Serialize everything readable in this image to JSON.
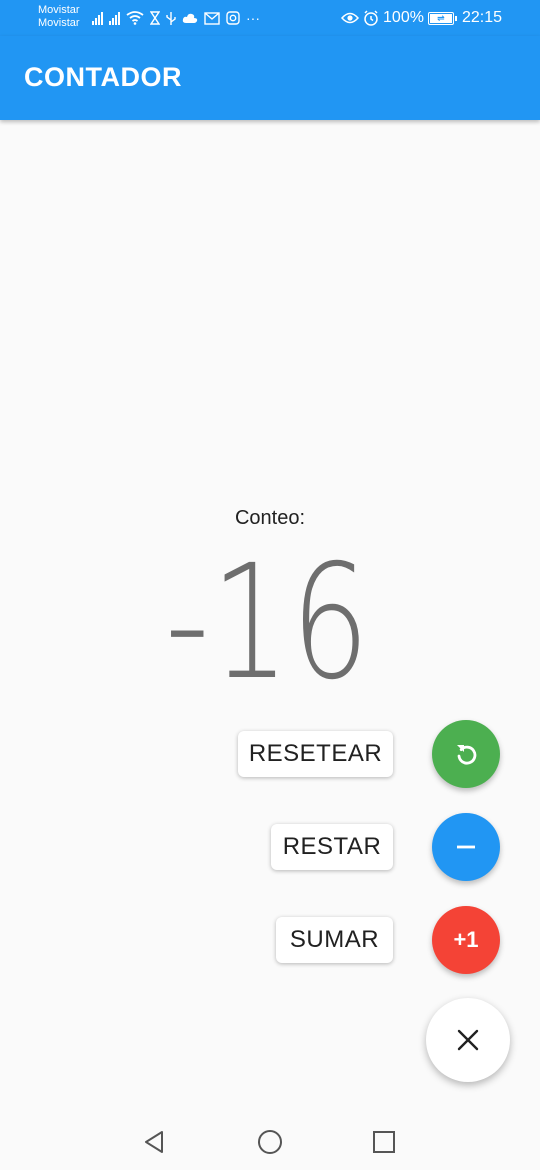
{
  "status_bar": {
    "carrier_1": "Movistar",
    "carrier_2": "Movistar",
    "left_icons": [
      "signal-icon",
      "signal-icon",
      "wifi-icon",
      "hourglass-icon",
      "usb-icon",
      "cloud-icon",
      "mail-icon",
      "instagram-icon",
      "more-icon"
    ],
    "more": "···",
    "battery_percent": "100%",
    "time": "22:15"
  },
  "app_bar": {
    "title": "CONTADOR",
    "color": "#2196f3"
  },
  "counter": {
    "label": "Conteo:",
    "value": "-16"
  },
  "speed_dial": {
    "reset": {
      "label": "RESETEAR",
      "icon": "refresh-icon",
      "color": "#4caf50"
    },
    "subtract": {
      "label": "RESTAR",
      "icon": "minus-icon",
      "color": "#2196f3"
    },
    "add": {
      "label": "SUMAR",
      "icon_text": "+1",
      "color": "#f44336"
    },
    "close": {
      "icon": "close-icon"
    }
  },
  "nav_bar": {
    "icons": [
      "back-icon",
      "home-icon",
      "recents-icon"
    ]
  }
}
